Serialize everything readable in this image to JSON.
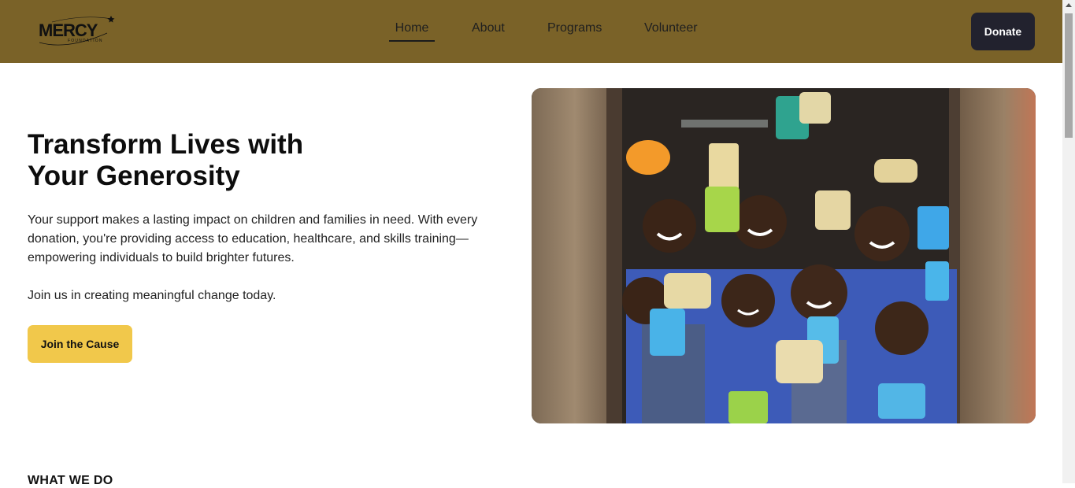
{
  "brand": {
    "name": "MERCY",
    "tagline": "FOUNDATION"
  },
  "nav": {
    "links": [
      {
        "label": "Home",
        "active": true
      },
      {
        "label": "About"
      },
      {
        "label": "Programs"
      },
      {
        "label": "Volunteer"
      }
    ],
    "cta_label": "Donate"
  },
  "hero": {
    "title_line1": "Transform Lives with",
    "title_line2": "Your Generosity",
    "paragraph1": "Your support makes a lasting impact on children and families in need. With every donation, you're providing access to education, healthcare, and skills training—empowering individuals to build brighter futures.",
    "paragraph2": "Join us in creating meaningful change today.",
    "button_label": "Join the Cause"
  },
  "section": {
    "label": "WHAT WE DO"
  },
  "colors": {
    "navbar_bg": "#7a6228",
    "donate_bg": "#22222e",
    "join_bg": "#f1c84b"
  }
}
